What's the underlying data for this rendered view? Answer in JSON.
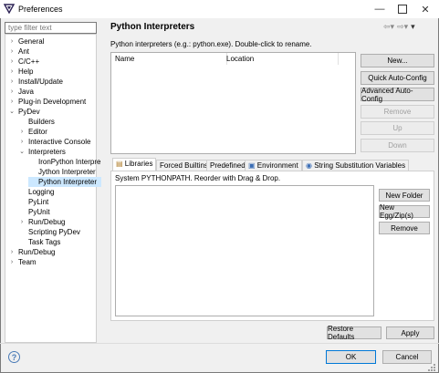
{
  "window": {
    "title": "Preferences"
  },
  "filter": {
    "placeholder": "type filter text"
  },
  "tree": [
    {
      "label": "General",
      "chev": "›",
      "indent": 0
    },
    {
      "label": "Ant",
      "chev": "›",
      "indent": 0
    },
    {
      "label": "C/C++",
      "chev": "›",
      "indent": 0
    },
    {
      "label": "Help",
      "chev": "›",
      "indent": 0
    },
    {
      "label": "Install/Update",
      "chev": "›",
      "indent": 0
    },
    {
      "label": "Java",
      "chev": "›",
      "indent": 0
    },
    {
      "label": "Plug-in Development",
      "chev": "›",
      "indent": 0
    },
    {
      "label": "PyDev",
      "chev": "⌄",
      "indent": 0
    },
    {
      "label": "Builders",
      "chev": "",
      "indent": 1
    },
    {
      "label": "Editor",
      "chev": "›",
      "indent": 1
    },
    {
      "label": "Interactive Console",
      "chev": "›",
      "indent": 1
    },
    {
      "label": "Interpreters",
      "chev": "⌄",
      "indent": 1
    },
    {
      "label": "IronPython Interpre",
      "chev": "",
      "indent": 2
    },
    {
      "label": "Jython Interpreter",
      "chev": "",
      "indent": 2
    },
    {
      "label": "Python Interpreter",
      "chev": "",
      "indent": 2,
      "selected": true
    },
    {
      "label": "Logging",
      "chev": "",
      "indent": 1
    },
    {
      "label": "PyLint",
      "chev": "",
      "indent": 1
    },
    {
      "label": "PyUnit",
      "chev": "",
      "indent": 1
    },
    {
      "label": "Run/Debug",
      "chev": "›",
      "indent": 1
    },
    {
      "label": "Scripting PyDev",
      "chev": "",
      "indent": 1
    },
    {
      "label": "Task Tags",
      "chev": "",
      "indent": 1
    },
    {
      "label": "Run/Debug",
      "chev": "›",
      "indent": 0
    },
    {
      "label": "Team",
      "chev": "›",
      "indent": 0
    }
  ],
  "panel": {
    "title": "Python Interpreters",
    "description": "Python interpreters (e.g.: python.exe).   Double-click to rename.",
    "columns": [
      "Name",
      "Location"
    ]
  },
  "buttons": {
    "new": "New...",
    "quick": "Quick Auto-Config",
    "advanced": "Advanced Auto-Config",
    "remove": "Remove",
    "up": "Up",
    "down": "Down"
  },
  "tabs": [
    "Libraries",
    "Forced Builtins",
    "Predefined",
    "Environment",
    "String Substitution Variables"
  ],
  "libraries": {
    "caption": "System PYTHONPATH.   Reorder with Drag & Drop.",
    "new_folder": "New Folder",
    "new_egg": "New Egg/Zip(s)",
    "remove": "Remove"
  },
  "footer": {
    "restore": "Restore Defaults",
    "apply": "Apply",
    "ok": "OK",
    "cancel": "Cancel",
    "help_glyph": "?"
  },
  "colors": {
    "selection": "#cce8ff",
    "accent": "#0078d7"
  }
}
